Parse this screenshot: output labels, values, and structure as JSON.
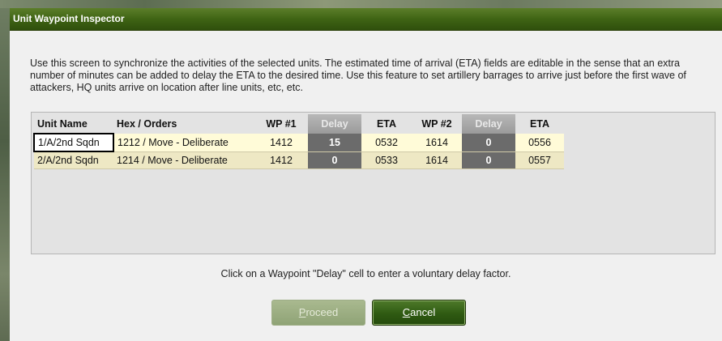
{
  "window": {
    "title": "Unit Waypoint Inspector"
  },
  "instructions": "Use this screen to synchronize the activities of the selected units.  The estimated time of arrival (ETA) fields are editable in the sense that an extra number of minutes can be added to delay the ETA to the desired time.  Use this feature to set artillery barrages to arrive just before the first wave of attackers, HQ units arrive on location after line units, etc, etc.",
  "table": {
    "headers": {
      "unit_name": "Unit Name",
      "hex_orders": "Hex / Orders",
      "wp1": "WP #1",
      "delay1": "Delay",
      "eta1": "ETA",
      "wp2": "WP #2",
      "delay2": "Delay",
      "eta2": "ETA"
    },
    "rows": [
      {
        "unit_name": "1/A/2nd Sqdn",
        "hex_orders": "1212 / Move - Deliberate",
        "wp1": "1412",
        "delay1": "15",
        "eta1": "0532",
        "wp2": "1614",
        "delay2": "0",
        "eta2": "0556"
      },
      {
        "unit_name": "2/A/2nd Sqdn",
        "hex_orders": "1214 / Move - Deliberate",
        "wp1": "1412",
        "delay1": "0",
        "eta1": "0533",
        "wp2": "1614",
        "delay2": "0",
        "eta2": "0557"
      }
    ]
  },
  "hint": "Click on a Waypoint \"Delay\" cell to enter a voluntary delay factor.",
  "buttons": {
    "proceed": {
      "first_letter": "P",
      "rest": "roceed",
      "enabled": false
    },
    "cancel": {
      "first_letter": "C",
      "rest": "ancel",
      "enabled": true
    }
  },
  "colors": {
    "titlebar": "#3f6414",
    "delay_cell": "#6b6b6b",
    "row_selected": "#fffbd8",
    "row_alt": "#eee8c4"
  }
}
